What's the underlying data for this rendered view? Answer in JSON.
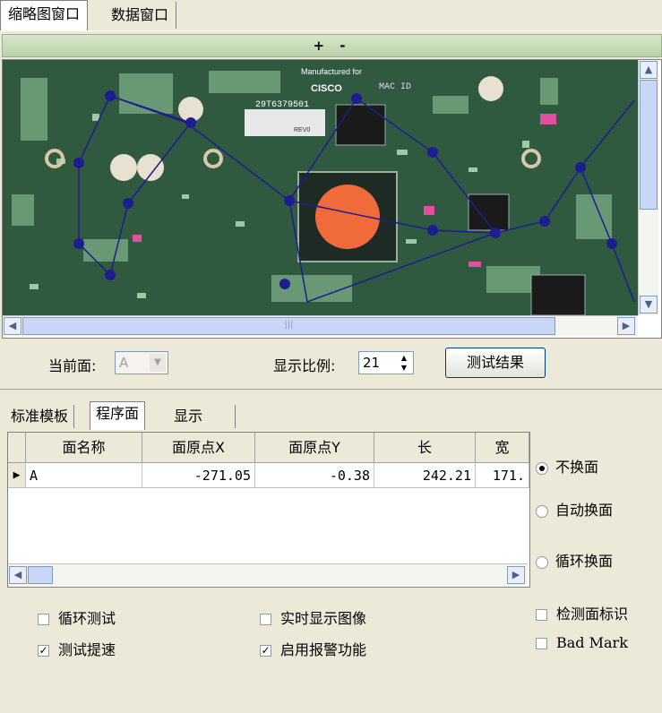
{
  "top_tabs": [
    "缩略图窗口",
    "数据窗口"
  ],
  "zoom_bar": {
    "label": "+ -"
  },
  "board": {
    "labels": {
      "manufactured": "Manufactured for",
      "brand": "CISCO",
      "mac": "MAC ID",
      "serial": "29T6379501",
      "rev": "REV0"
    }
  },
  "controls": {
    "current_face_label": "当前面:",
    "current_face_value": "A",
    "scale_label": "显示比例:",
    "scale_value": "21",
    "test_result_button": "测试结果"
  },
  "lower_tabs": [
    "标准模板",
    "程序面",
    "显示"
  ],
  "grid": {
    "columns": [
      "面名称",
      "面原点X",
      "面原点Y",
      "长",
      "宽"
    ],
    "rows": [
      {
        "name": "A",
        "x": "-271.05",
        "y": "-0.38",
        "len": "242.21",
        "wid": "171."
      }
    ]
  },
  "radios": [
    {
      "label": "不换面",
      "checked": true
    },
    {
      "label": "自动换面",
      "checked": false
    },
    {
      "label": "循环换面",
      "checked": false
    }
  ],
  "checkboxes": [
    {
      "label": "循环测试",
      "checked": false
    },
    {
      "label": "测试提速",
      "checked": true
    },
    {
      "label": "实时显示图像",
      "checked": false
    },
    {
      "label": "启用报警功能",
      "checked": true
    },
    {
      "label": "检测面标识",
      "checked": false
    },
    {
      "label": "Bad Mark",
      "checked": false
    }
  ]
}
